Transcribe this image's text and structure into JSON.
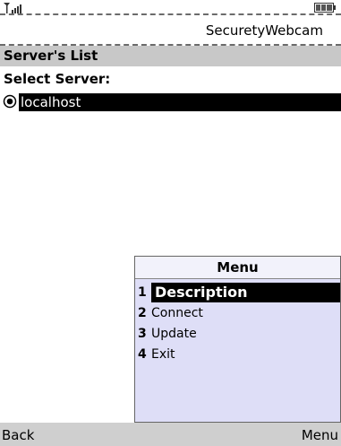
{
  "status": {
    "signal": "signal-icon",
    "battery": "battery-icon"
  },
  "app": {
    "title": "SecuretyWebcam"
  },
  "screen": {
    "header": "Server's List",
    "select_label": "Select Server:",
    "servers": [
      {
        "name": "localhost",
        "selected": true
      }
    ]
  },
  "menu": {
    "title": "Menu",
    "items": [
      {
        "num": "1",
        "label": "Description",
        "highlighted": true
      },
      {
        "num": "2",
        "label": "Connect"
      },
      {
        "num": "3",
        "label": "Update"
      },
      {
        "num": "4",
        "label": "Exit"
      }
    ]
  },
  "softkeys": {
    "left": "Back",
    "right": "Menu"
  },
  "colors": {
    "header_bg": "#c8c8c8",
    "menu_bg": "#dedef7",
    "highlight": "#000000",
    "softkey_bg": "#cfcfcf"
  }
}
